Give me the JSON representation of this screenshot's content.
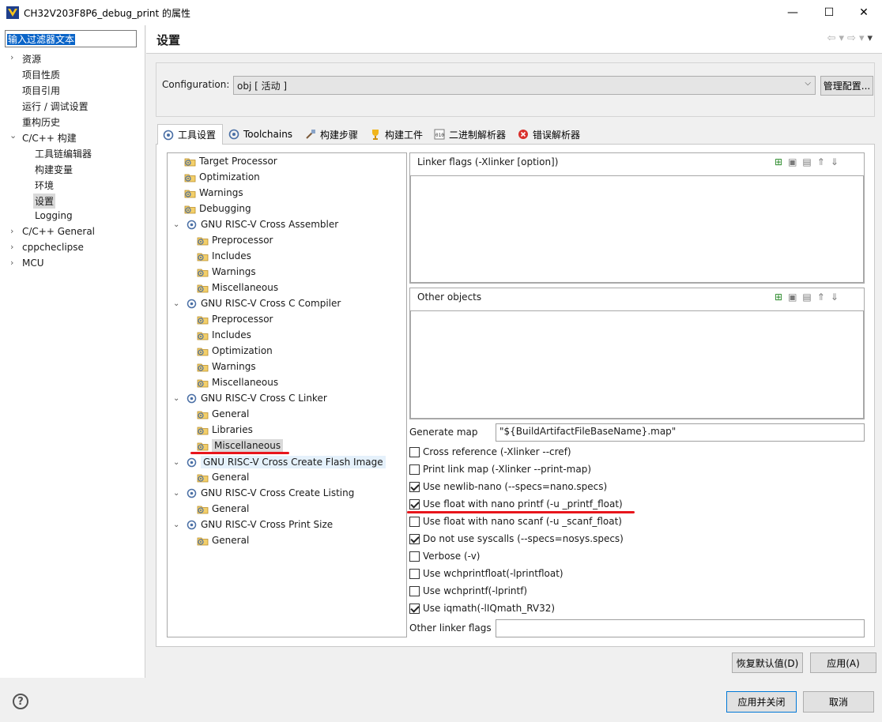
{
  "window": {
    "title": "CH32V203F8P6_debug_print 的属性",
    "minimize": "—",
    "maximize": "☐",
    "close": "✕"
  },
  "sidebar": {
    "filter_text": "输入过滤器文本",
    "items": [
      {
        "label": "资源",
        "arrow": "›"
      },
      {
        "label": "项目性质"
      },
      {
        "label": "项目引用"
      },
      {
        "label": "运行 / 调试设置"
      },
      {
        "label": "重构历史"
      },
      {
        "label": "C/C++ 构建",
        "arrow": "⌄"
      },
      {
        "label": "工具链编辑器"
      },
      {
        "label": "构建变量"
      },
      {
        "label": "环境"
      },
      {
        "label": "设置"
      },
      {
        "label": "Logging"
      },
      {
        "label": "C/C++ General",
        "arrow": "›"
      },
      {
        "label": "cppcheclipse",
        "arrow": "›"
      },
      {
        "label": "MCU",
        "arrow": "›"
      }
    ]
  },
  "header": {
    "title": "设置"
  },
  "configuration": {
    "label": "Configuration:",
    "value": "obj  [ 活动 ]",
    "manage_button": "管理配置..."
  },
  "tabs": [
    {
      "label": "工具设置",
      "icon": "tool-settings-icon"
    },
    {
      "label": "Toolchains",
      "icon": "toolchains-icon"
    },
    {
      "label": "构建步骤",
      "icon": "build-steps-icon"
    },
    {
      "label": "构建工件",
      "icon": "build-artifact-icon"
    },
    {
      "label": "二进制解析器",
      "icon": "binary-parser-icon"
    },
    {
      "label": "错误解析器",
      "icon": "error-parser-icon"
    }
  ],
  "tree": {
    "nodes": [
      {
        "label": "Target Processor"
      },
      {
        "label": "Optimization"
      },
      {
        "label": "Warnings"
      },
      {
        "label": "Debugging"
      },
      {
        "label": "GNU RISC-V Cross Assembler"
      },
      {
        "label": "Preprocessor"
      },
      {
        "label": "Includes"
      },
      {
        "label": "Warnings"
      },
      {
        "label": "Miscellaneous"
      },
      {
        "label": "GNU RISC-V Cross C Compiler"
      },
      {
        "label": "Preprocessor"
      },
      {
        "label": "Includes"
      },
      {
        "label": "Optimization"
      },
      {
        "label": "Warnings"
      },
      {
        "label": "Miscellaneous"
      },
      {
        "label": "GNU RISC-V Cross C Linker"
      },
      {
        "label": "General"
      },
      {
        "label": "Libraries"
      },
      {
        "label": "Miscellaneous"
      },
      {
        "label": "GNU RISC-V Cross Create Flash Image"
      },
      {
        "label": "General"
      },
      {
        "label": "GNU RISC-V Cross Create Listing"
      },
      {
        "label": "General"
      },
      {
        "label": "GNU RISC-V Cross Print Size"
      },
      {
        "label": "General"
      }
    ]
  },
  "linker_flags": {
    "label": "Linker flags (-Xlinker [option])"
  },
  "other_objects": {
    "label": "Other objects"
  },
  "generate_map": {
    "label": "Generate map",
    "value": "\"${BuildArtifactFileBaseName}.map\""
  },
  "checkboxes": [
    {
      "label": "Cross reference (-Xlinker --cref)",
      "checked": false
    },
    {
      "label": "Print link map (-Xlinker --print-map)",
      "checked": false
    },
    {
      "label": "Use newlib-nano (--specs=nano.specs)",
      "checked": true
    },
    {
      "label": "Use float with nano printf (-u _printf_float)",
      "checked": true
    },
    {
      "label": "Use float with nano scanf (-u _scanf_float)",
      "checked": false
    },
    {
      "label": "Do not use syscalls (--specs=nosys.specs)",
      "checked": true
    },
    {
      "label": "Verbose (-v)",
      "checked": false
    },
    {
      "label": "Use wchprintfloat(-lprintfloat)",
      "checked": false
    },
    {
      "label": "Use wchprintf(-lprintf)",
      "checked": false
    },
    {
      "label": "Use iqmath(-lIQmath_RV32)",
      "checked": true
    }
  ],
  "other_linker_flags": {
    "label": "Other linker flags",
    "value": ""
  },
  "buttons": {
    "restore_defaults": "恢复默认值(D)",
    "apply": "应用(A)",
    "apply_and_close": "应用并关闭",
    "cancel": "取消",
    "help": "?"
  },
  "colors": {
    "annotation_red": "#e8151c",
    "selection_blue": "#0a64c8"
  }
}
